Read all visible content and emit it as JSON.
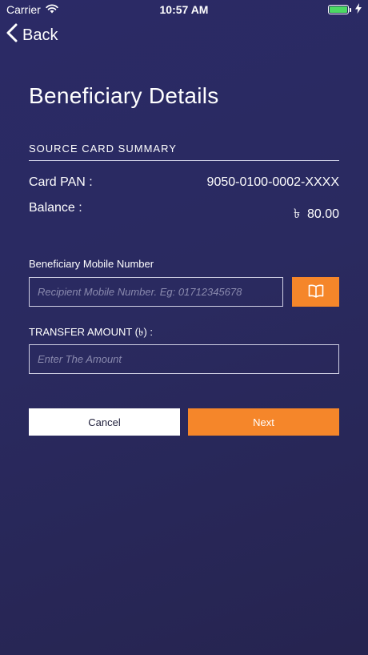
{
  "status_bar": {
    "carrier": "Carrier",
    "time": "10:57 AM"
  },
  "nav": {
    "back_label": "Back"
  },
  "page": {
    "title": "Beneficiary Details"
  },
  "summary": {
    "heading": "SOURCE CARD SUMMARY",
    "card_pan_label": "Card PAN :",
    "card_pan_value": "9050-0100-0002-XXXX",
    "balance_label": "Balance :",
    "balance_value": "৳  80.00"
  },
  "form": {
    "mobile_label": "Beneficiary Mobile Number",
    "mobile_placeholder": "Recipient Mobile Number. Eg: 01712345678",
    "amount_label": "TRANSFER AMOUNT (৳) :",
    "amount_placeholder": "Enter The Amount"
  },
  "actions": {
    "cancel_label": "Cancel",
    "next_label": "Next"
  },
  "colors": {
    "accent": "#f5862a",
    "background": "#2a2a60",
    "battery": "#4cd964"
  },
  "icons": {
    "wifi": "wifi-icon",
    "battery": "battery-icon",
    "charging": "charging-bolt-icon",
    "back": "chevron-left-icon",
    "contacts": "open-book-icon"
  }
}
